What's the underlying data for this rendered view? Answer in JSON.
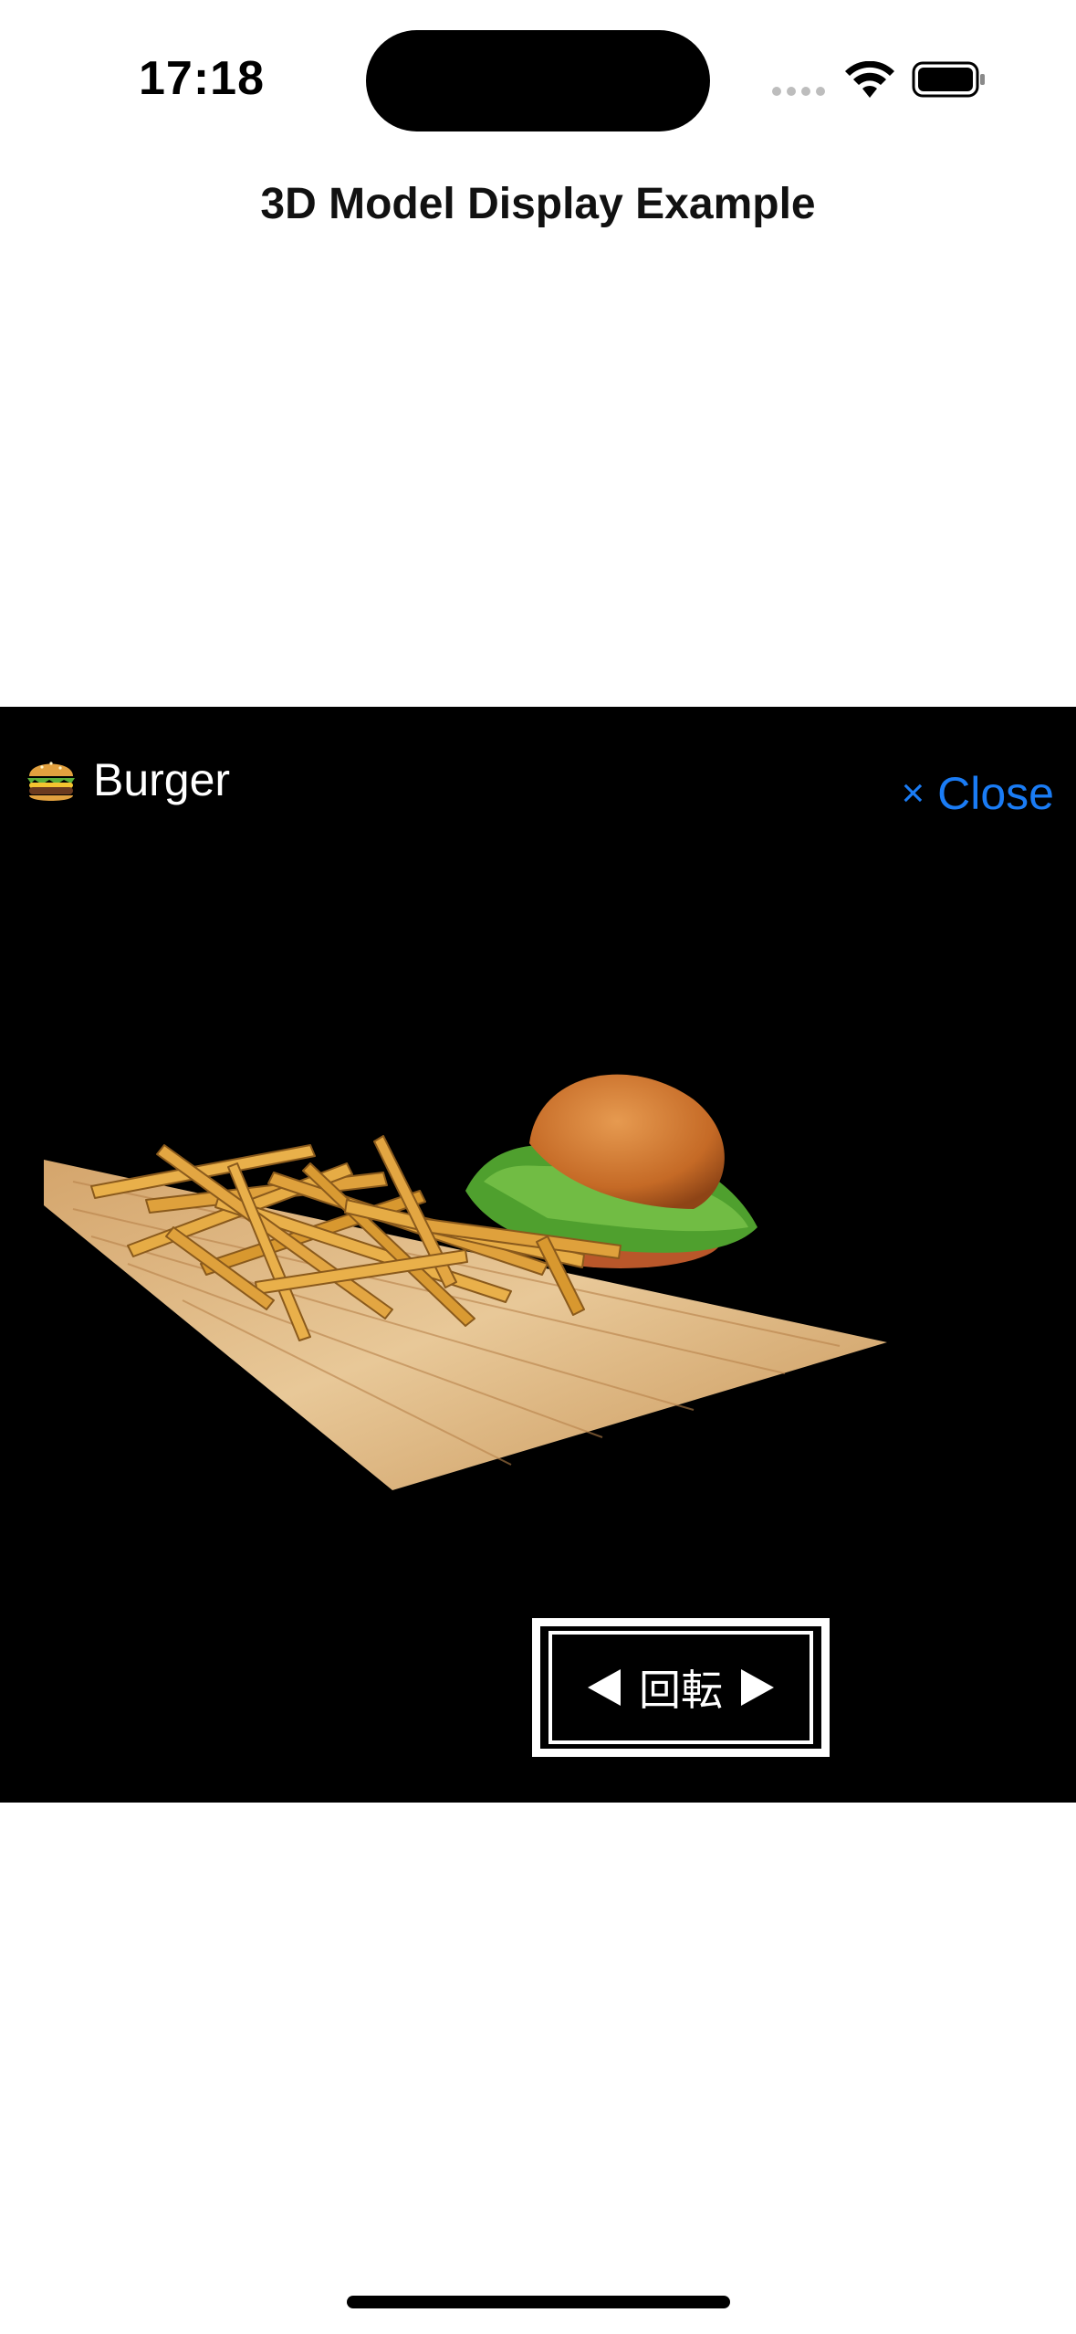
{
  "status_bar": {
    "time": "17:18",
    "icons": [
      "signal-dots-icon",
      "wifi-icon",
      "battery-icon"
    ]
  },
  "nav": {
    "title": "3D Model Display Example"
  },
  "viewer": {
    "model_emoji": "hamburger-icon",
    "model_name": "Burger",
    "close_symbol": "×",
    "close_label": "Close",
    "rotate_label": "回転",
    "colors": {
      "background": "#000000",
      "accent": "#1a7cf5",
      "text": "#ffffff"
    }
  }
}
